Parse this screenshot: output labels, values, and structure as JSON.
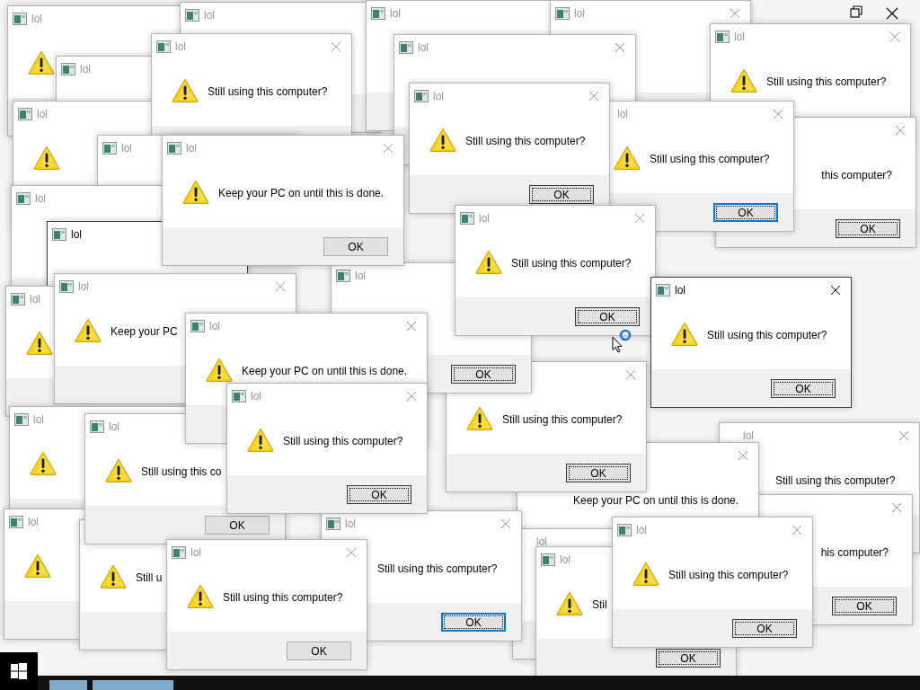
{
  "windows": [
    {
      "title": "lol",
      "active": false
    },
    {
      "title": "lol",
      "active": false
    },
    {
      "title": "lol",
      "active": false
    },
    {
      "title": "lol",
      "active": false
    },
    {
      "title": "lol",
      "message": "Still using this computer?",
      "active": false
    },
    {
      "title": "lol",
      "active": false
    },
    {
      "title": "lol",
      "active": false
    },
    {
      "title": "lol",
      "message": "Still using this computer?",
      "active": false
    },
    {
      "title": "lol",
      "active": false
    },
    {
      "message": "this computer?",
      "button": {
        "label": "OK",
        "focused": true,
        "default": false
      },
      "active": false
    },
    {
      "title": "lol",
      "message": "Still using this computer?",
      "button": {
        "label": "OK",
        "focused": true,
        "default": true
      },
      "active": false
    },
    {
      "title": "lol",
      "active": false
    },
    {
      "title": "lol",
      "active": false
    },
    {
      "title": "lol",
      "active": true
    },
    {
      "title": "lol",
      "active": false
    },
    {
      "title": "lol",
      "message": "Keep your PC",
      "active": false
    },
    {
      "title": "lol",
      "active": false
    },
    {
      "title": "lol",
      "active": false
    },
    {
      "title": "lol",
      "message": "Still using this co",
      "button": {
        "label": "OK",
        "focused": false,
        "default": false
      },
      "active": false
    },
    {
      "message": "Still u",
      "active": false
    },
    {
      "title": "lol",
      "message": "Still using this computer?",
      "active": false
    },
    {
      "message": "his computer?",
      "button": {
        "label": "OK",
        "focused": true,
        "default": false
      },
      "active": false
    },
    {
      "message": "Still using this computer?",
      "button": {
        "label": "OK",
        "focused": true,
        "default": false
      },
      "active": false
    },
    {
      "message": "Keep your PC on until this is done.",
      "active": false
    },
    {
      "title": "lol",
      "button": {
        "label": "OK",
        "focused": true,
        "default": false
      },
      "active": false
    },
    {
      "title": "lol",
      "active": false
    },
    {
      "title": "lol",
      "message": "Still using this computer?",
      "button": {
        "label": "OK",
        "focused": true,
        "default": true
      },
      "active": false
    },
    {
      "title": "lol",
      "message": "Stil",
      "button": {
        "label": "OK",
        "focused": true,
        "default": false
      },
      "active": false
    },
    {
      "title": "lol",
      "message": "Keep your PC on until this is done.",
      "button": {
        "label": "OK",
        "focused": false,
        "default": false
      },
      "active": false
    },
    {
      "title": "lol",
      "message": "Still using this computer?",
      "button": {
        "label": "OK",
        "focused": true,
        "default": false
      },
      "active": false
    },
    {
      "title": "lol",
      "message": "Still using this computer?",
      "button": {
        "label": "OK",
        "focused": true,
        "default": false
      },
      "active": false
    },
    {
      "title": "lol",
      "message": "Keep your PC on until this is done.",
      "active": false
    },
    {
      "title": "lol",
      "message": "Still using this computer?",
      "button": {
        "label": "OK",
        "focused": true,
        "default": false
      },
      "active": false
    },
    {
      "title": "lol",
      "message": "Still using this computer?",
      "button": {
        "label": "OK",
        "focused": true,
        "default": false
      },
      "active": true
    },
    {
      "title": "lol",
      "message": "Still using this computer?",
      "button": {
        "label": "OK",
        "focused": false,
        "default": false
      },
      "active": false
    },
    {
      "title": "lol",
      "message": "Still using this computer?",
      "button": {
        "label": "OK",
        "focused": true,
        "default": false
      },
      "active": false
    }
  ]
}
